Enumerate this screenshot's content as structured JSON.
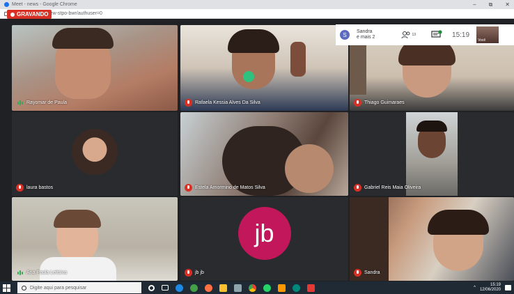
{
  "browser": {
    "title": "Meet - news - Google Chrome",
    "url": "meet.google.com/ew-stpo-bwr/authuser=0",
    "window_controls": [
      "–",
      "⧉",
      "✕"
    ]
  },
  "recording_label": "GRAVANDO",
  "top_bar": {
    "participant_initial": "S",
    "participant_summary_line1": "Sandra",
    "participant_summary_line2": "e mais 2",
    "people_count": "13",
    "time": "15:19",
    "self_label": "Você"
  },
  "participants": [
    {
      "name": "Rayomar de Paula",
      "status": "speaking"
    },
    {
      "name": "Rafaela Kessia Alves Da Silva",
      "status": "muted"
    },
    {
      "name": "Thiago Guimaraes",
      "status": "muted"
    },
    {
      "name": "laura bastos",
      "status": "muted"
    },
    {
      "name": "Estela Amormino de Matos Silva",
      "status": "muted"
    },
    {
      "name": "Gabriel Reis Maia Oliveira",
      "status": "muted"
    },
    {
      "name": "Ana Paula Leitsiva",
      "status": "speaking"
    },
    {
      "name": "jb jb",
      "status": "muted",
      "initials": "jb"
    },
    {
      "name": "Sandra",
      "status": "muted"
    }
  ],
  "taskbar": {
    "search_placeholder": "Digite aqui para pesquisar",
    "tray_time": "15:19",
    "tray_date": "12/06/2020"
  },
  "colors": {
    "meet_bg": "#202124",
    "record_red": "#d93025",
    "avatar_jb": "#c2185b"
  }
}
